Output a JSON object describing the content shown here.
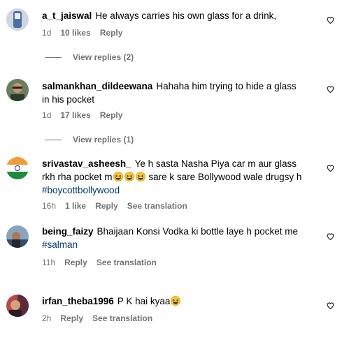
{
  "comments": [
    {
      "username": "a_t_jaiswal",
      "text": "He always carries his own glass for a drink,",
      "time": "1d",
      "likes": "10 likes",
      "reply": "Reply",
      "view_replies": "View replies (2)",
      "avatar_icon": "profile-photo"
    },
    {
      "username": "salmankhan_dildeewana",
      "text": "Hahaha him trying to hide a glass in his pocket",
      "time": "1d",
      "likes": "17 likes",
      "reply": "Reply",
      "view_replies": "View replies (1)",
      "avatar_icon": "profile-photo"
    },
    {
      "username": "srivastav_asheesh_",
      "text_part1": "Ye h sasta Nasha Piya car m aur glass rkh rha pocket m",
      "text_part2": "sare k sare Bollywood wale drugsy h",
      "hashtag": "#boycottbollywood",
      "time": "16h",
      "likes": "1 like",
      "reply": "Reply",
      "see_translation": "See translation",
      "avatar_icon": "india-flag"
    },
    {
      "username": "being_faizy",
      "text": "Bhaijaan Konsi Vodka ki bottle laye h pocket me",
      "hashtag": "#salman",
      "time": "11h",
      "reply": "Reply",
      "see_translation": "See translation",
      "avatar_icon": "profile-photo"
    },
    {
      "username": "irfan_theba1996",
      "text": "P K hai kyaa",
      "time": "2h",
      "reply": "Reply",
      "see_translation": "See translation",
      "avatar_icon": "profile-photo"
    }
  ],
  "icons": {
    "like": "heart-outline-icon",
    "emoji": "grinning-squinting-face-emoji"
  },
  "colors": {
    "meta_text": "#737373",
    "hashtag": "#00376b",
    "text": "#000000"
  }
}
